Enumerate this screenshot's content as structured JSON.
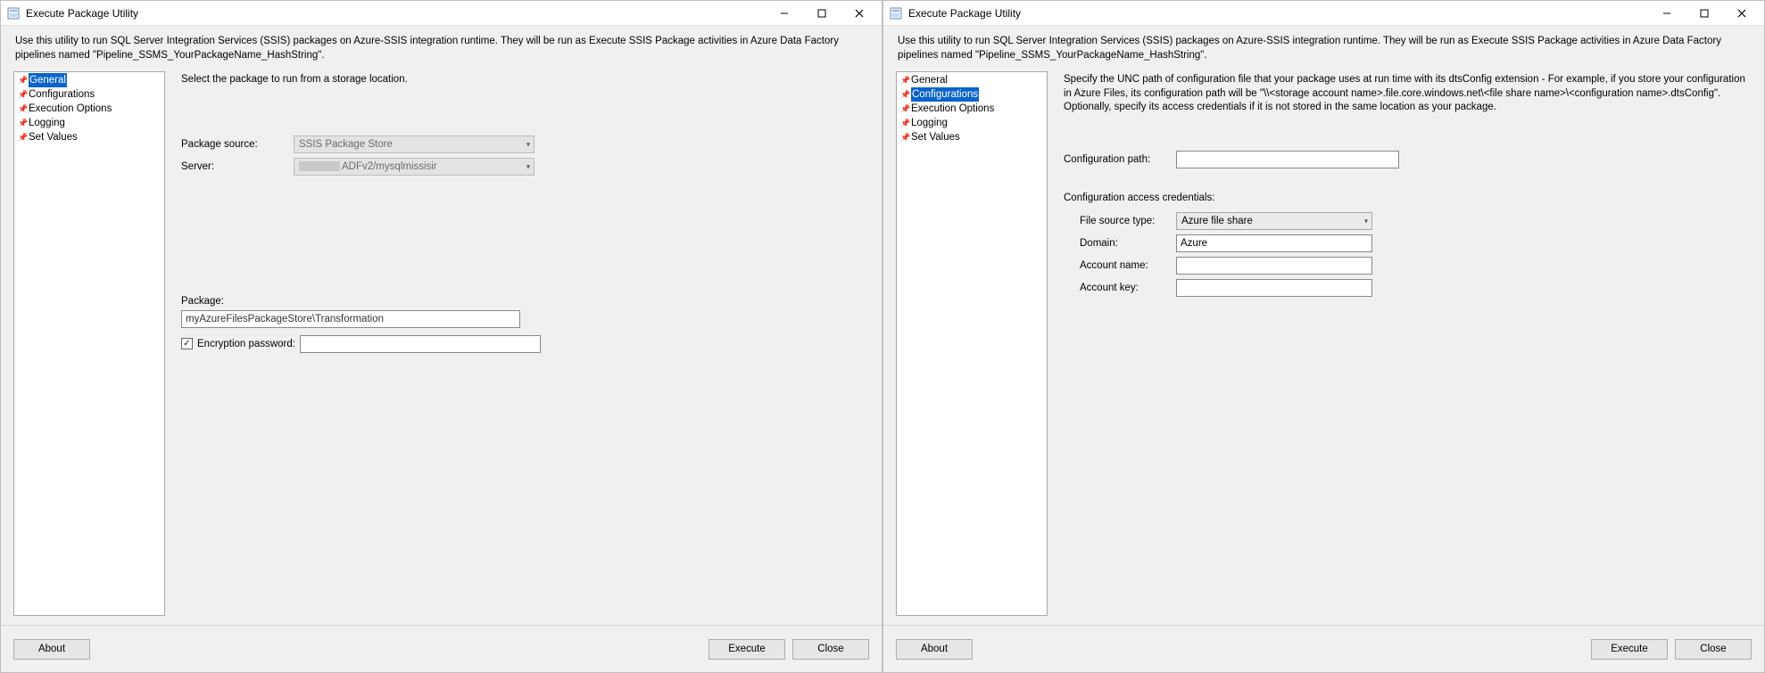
{
  "window_title": "Execute Package Utility",
  "description": "Use this utility to run SQL Server Integration Services (SSIS) packages on Azure-SSIS integration runtime. They will be run as Execute SSIS Package activities in Azure Data Factory pipelines named \"Pipeline_SSMS_YourPackageName_HashString\".",
  "nav": {
    "items": [
      {
        "label": "General"
      },
      {
        "label": "Configurations"
      },
      {
        "label": "Execution Options"
      },
      {
        "label": "Logging"
      },
      {
        "label": "Set Values"
      }
    ]
  },
  "buttons": {
    "about": "About",
    "execute": "Execute",
    "close": "Close"
  },
  "left": {
    "pane_desc": "Select the package to run from a storage location.",
    "labels": {
      "package_source": "Package source:",
      "server": "Server:",
      "package": "Package:",
      "encryption_password": "Encryption password:"
    },
    "values": {
      "package_source": "SSIS Package Store",
      "server_suffix": "ADFv2/mysqlmissisir",
      "package": "myAzureFilesPackageStore\\Transformation",
      "encryption_password": "",
      "encryption_checked": true
    }
  },
  "right": {
    "pane_desc": "Specify the UNC path of configuration file that your package uses at run time with its dtsConfig extension - For example, if you store your configuration in Azure Files, its configuration path will be \"\\\\<storage account name>.file.core.windows.net\\<file share name>\\<configuration name>.dtsConfig\".  Optionally, specify its access credentials if it is not stored in the same location as your package.",
    "labels": {
      "config_path": "Configuration path:",
      "cred_heading": "Configuration access credentials:",
      "file_source_type": "File source type:",
      "domain": "Domain:",
      "account_name": "Account name:",
      "account_key": "Account key:"
    },
    "values": {
      "config_path": "",
      "file_source_type": "Azure file share",
      "domain": "Azure",
      "account_name": "",
      "account_key": ""
    }
  }
}
